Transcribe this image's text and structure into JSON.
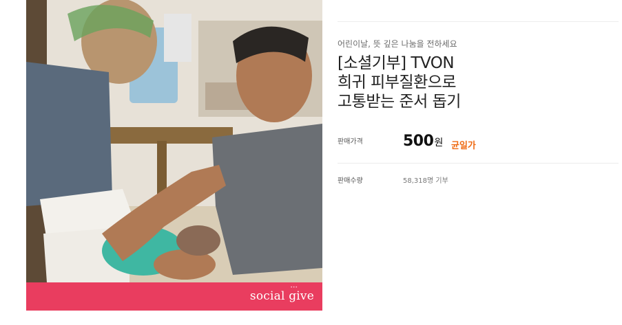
{
  "product": {
    "subtitle": "어린이날, 뜻 깊은 나눔을 전하세요",
    "title_lines": [
      "[소셜기부] TVON",
      "희귀 피부질환으로",
      "고통받는 준서 돕기"
    ],
    "price_label": "판매가격",
    "price_value": "500",
    "price_unit": "원",
    "price_badge": "균일가",
    "quantity_label": "판매수량",
    "quantity_value": "58,318명 기부"
  },
  "banner": {
    "logo_text": "social give",
    "brand_color": "#e93d5f"
  },
  "colors": {
    "badge": "#ef6a12",
    "text": "#222222"
  }
}
